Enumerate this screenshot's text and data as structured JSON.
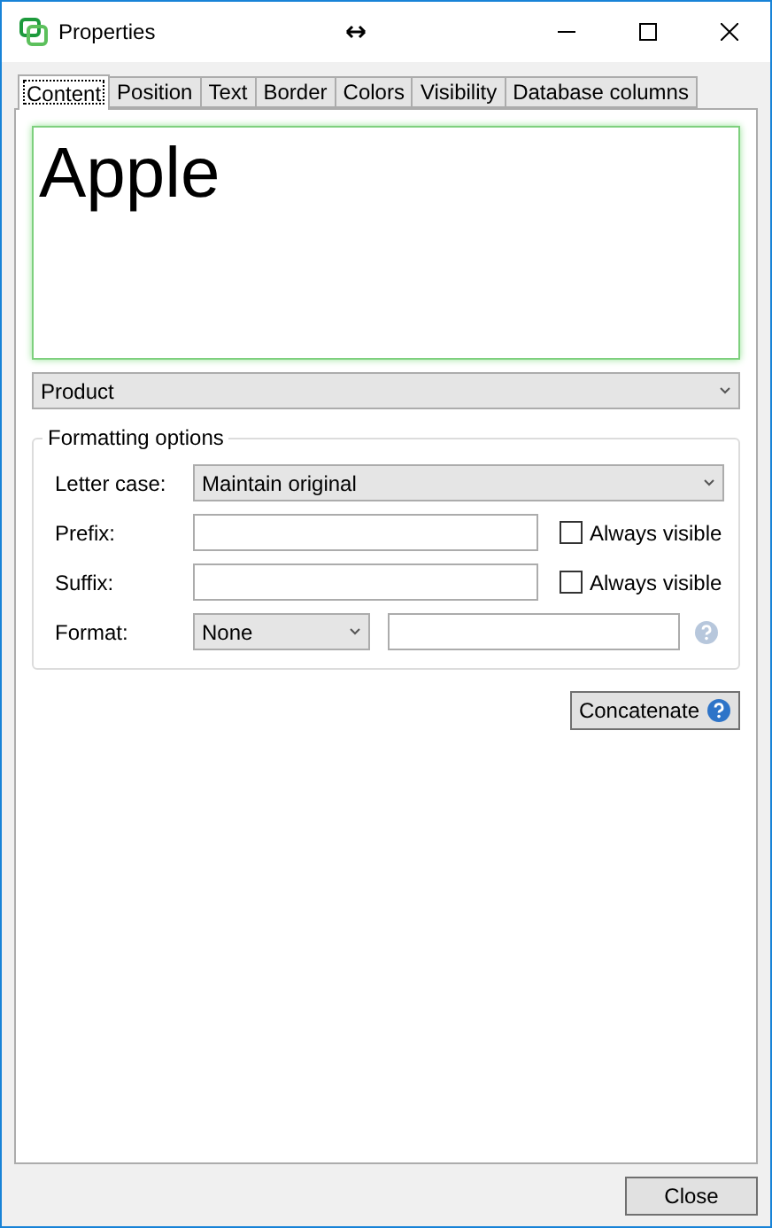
{
  "window": {
    "title": "Properties"
  },
  "tabs": [
    {
      "label": "Content",
      "selected": true
    },
    {
      "label": "Position",
      "selected": false
    },
    {
      "label": "Text",
      "selected": false
    },
    {
      "label": "Border",
      "selected": false
    },
    {
      "label": "Colors",
      "selected": false
    },
    {
      "label": "Visibility",
      "selected": false
    },
    {
      "label": "Database columns",
      "selected": false
    }
  ],
  "preview": {
    "text": "Apple"
  },
  "field_select": {
    "value": "Product"
  },
  "formatting": {
    "title": "Formatting options",
    "letter_case": {
      "label": "Letter case:",
      "value": "Maintain original"
    },
    "prefix": {
      "label": "Prefix:",
      "checkbox_label": "Always visible",
      "checked": false
    },
    "suffix": {
      "label": "Suffix:",
      "checkbox_label": "Always visible",
      "checked": false
    },
    "format": {
      "label": "Format:",
      "value": "None"
    }
  },
  "concatenate_button": "Concatenate",
  "close_button": "Close"
}
